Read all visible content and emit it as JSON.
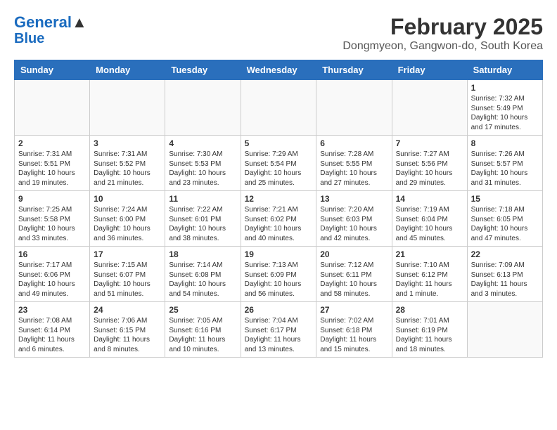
{
  "header": {
    "logo_line1": "General",
    "logo_line2": "Blue",
    "title": "February 2025",
    "subtitle": "Dongmyeon, Gangwon-do, South Korea"
  },
  "weekdays": [
    "Sunday",
    "Monday",
    "Tuesday",
    "Wednesday",
    "Thursday",
    "Friday",
    "Saturday"
  ],
  "weeks": [
    [
      {
        "day": "",
        "info": ""
      },
      {
        "day": "",
        "info": ""
      },
      {
        "day": "",
        "info": ""
      },
      {
        "day": "",
        "info": ""
      },
      {
        "day": "",
        "info": ""
      },
      {
        "day": "",
        "info": ""
      },
      {
        "day": "1",
        "info": "Sunrise: 7:32 AM\nSunset: 5:49 PM\nDaylight: 10 hours\nand 17 minutes."
      }
    ],
    [
      {
        "day": "2",
        "info": "Sunrise: 7:31 AM\nSunset: 5:51 PM\nDaylight: 10 hours\nand 19 minutes."
      },
      {
        "day": "3",
        "info": "Sunrise: 7:31 AM\nSunset: 5:52 PM\nDaylight: 10 hours\nand 21 minutes."
      },
      {
        "day": "4",
        "info": "Sunrise: 7:30 AM\nSunset: 5:53 PM\nDaylight: 10 hours\nand 23 minutes."
      },
      {
        "day": "5",
        "info": "Sunrise: 7:29 AM\nSunset: 5:54 PM\nDaylight: 10 hours\nand 25 minutes."
      },
      {
        "day": "6",
        "info": "Sunrise: 7:28 AM\nSunset: 5:55 PM\nDaylight: 10 hours\nand 27 minutes."
      },
      {
        "day": "7",
        "info": "Sunrise: 7:27 AM\nSunset: 5:56 PM\nDaylight: 10 hours\nand 29 minutes."
      },
      {
        "day": "8",
        "info": "Sunrise: 7:26 AM\nSunset: 5:57 PM\nDaylight: 10 hours\nand 31 minutes."
      }
    ],
    [
      {
        "day": "9",
        "info": "Sunrise: 7:25 AM\nSunset: 5:58 PM\nDaylight: 10 hours\nand 33 minutes."
      },
      {
        "day": "10",
        "info": "Sunrise: 7:24 AM\nSunset: 6:00 PM\nDaylight: 10 hours\nand 36 minutes."
      },
      {
        "day": "11",
        "info": "Sunrise: 7:22 AM\nSunset: 6:01 PM\nDaylight: 10 hours\nand 38 minutes."
      },
      {
        "day": "12",
        "info": "Sunrise: 7:21 AM\nSunset: 6:02 PM\nDaylight: 10 hours\nand 40 minutes."
      },
      {
        "day": "13",
        "info": "Sunrise: 7:20 AM\nSunset: 6:03 PM\nDaylight: 10 hours\nand 42 minutes."
      },
      {
        "day": "14",
        "info": "Sunrise: 7:19 AM\nSunset: 6:04 PM\nDaylight: 10 hours\nand 45 minutes."
      },
      {
        "day": "15",
        "info": "Sunrise: 7:18 AM\nSunset: 6:05 PM\nDaylight: 10 hours\nand 47 minutes."
      }
    ],
    [
      {
        "day": "16",
        "info": "Sunrise: 7:17 AM\nSunset: 6:06 PM\nDaylight: 10 hours\nand 49 minutes."
      },
      {
        "day": "17",
        "info": "Sunrise: 7:15 AM\nSunset: 6:07 PM\nDaylight: 10 hours\nand 51 minutes."
      },
      {
        "day": "18",
        "info": "Sunrise: 7:14 AM\nSunset: 6:08 PM\nDaylight: 10 hours\nand 54 minutes."
      },
      {
        "day": "19",
        "info": "Sunrise: 7:13 AM\nSunset: 6:09 PM\nDaylight: 10 hours\nand 56 minutes."
      },
      {
        "day": "20",
        "info": "Sunrise: 7:12 AM\nSunset: 6:11 PM\nDaylight: 10 hours\nand 58 minutes."
      },
      {
        "day": "21",
        "info": "Sunrise: 7:10 AM\nSunset: 6:12 PM\nDaylight: 11 hours\nand 1 minute."
      },
      {
        "day": "22",
        "info": "Sunrise: 7:09 AM\nSunset: 6:13 PM\nDaylight: 11 hours\nand 3 minutes."
      }
    ],
    [
      {
        "day": "23",
        "info": "Sunrise: 7:08 AM\nSunset: 6:14 PM\nDaylight: 11 hours\nand 6 minutes."
      },
      {
        "day": "24",
        "info": "Sunrise: 7:06 AM\nSunset: 6:15 PM\nDaylight: 11 hours\nand 8 minutes."
      },
      {
        "day": "25",
        "info": "Sunrise: 7:05 AM\nSunset: 6:16 PM\nDaylight: 11 hours\nand 10 minutes."
      },
      {
        "day": "26",
        "info": "Sunrise: 7:04 AM\nSunset: 6:17 PM\nDaylight: 11 hours\nand 13 minutes."
      },
      {
        "day": "27",
        "info": "Sunrise: 7:02 AM\nSunset: 6:18 PM\nDaylight: 11 hours\nand 15 minutes."
      },
      {
        "day": "28",
        "info": "Sunrise: 7:01 AM\nSunset: 6:19 PM\nDaylight: 11 hours\nand 18 minutes."
      },
      {
        "day": "",
        "info": ""
      }
    ]
  ]
}
